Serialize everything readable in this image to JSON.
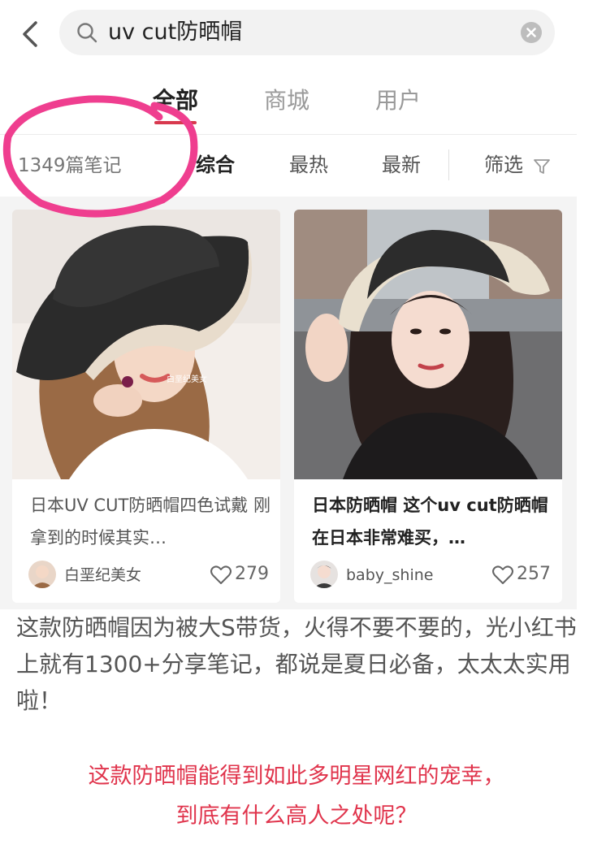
{
  "search": {
    "query": "uv cut防晒帽"
  },
  "tabs": [
    {
      "label": "全部",
      "active": true
    },
    {
      "label": "商城",
      "active": false
    },
    {
      "label": "用户",
      "active": false
    }
  ],
  "filter": {
    "note_count": "1349篇笔记",
    "options": [
      "综合",
      "最热",
      "最新"
    ],
    "screen_label": "筛选"
  },
  "cards": [
    {
      "title": "日本UV CUT防晒帽四色试戴 刚拿到的时候其实…",
      "author": "白垩纪美女",
      "likes": "279",
      "watermark": "白垩纪美女"
    },
    {
      "title": "日本防晒帽 这个uv cut防晒帽在日本非常难买，…",
      "author": "baby_shine",
      "likes": "257"
    }
  ],
  "article": {
    "paragraph": "这款防晒帽因为被大S带货，火得不要不要的，光小红书上就有1300+分享笔记，都说是夏日必备，太太太实用啦！",
    "highlight_line1": "这款防晒帽能得到如此多明星网红的宠幸，",
    "highlight_line2": "到底有什么高人之处呢？"
  },
  "colors": {
    "accent": "#d8394e",
    "annotation": "#ef3e8f",
    "highlight_text": "#e0344c"
  }
}
